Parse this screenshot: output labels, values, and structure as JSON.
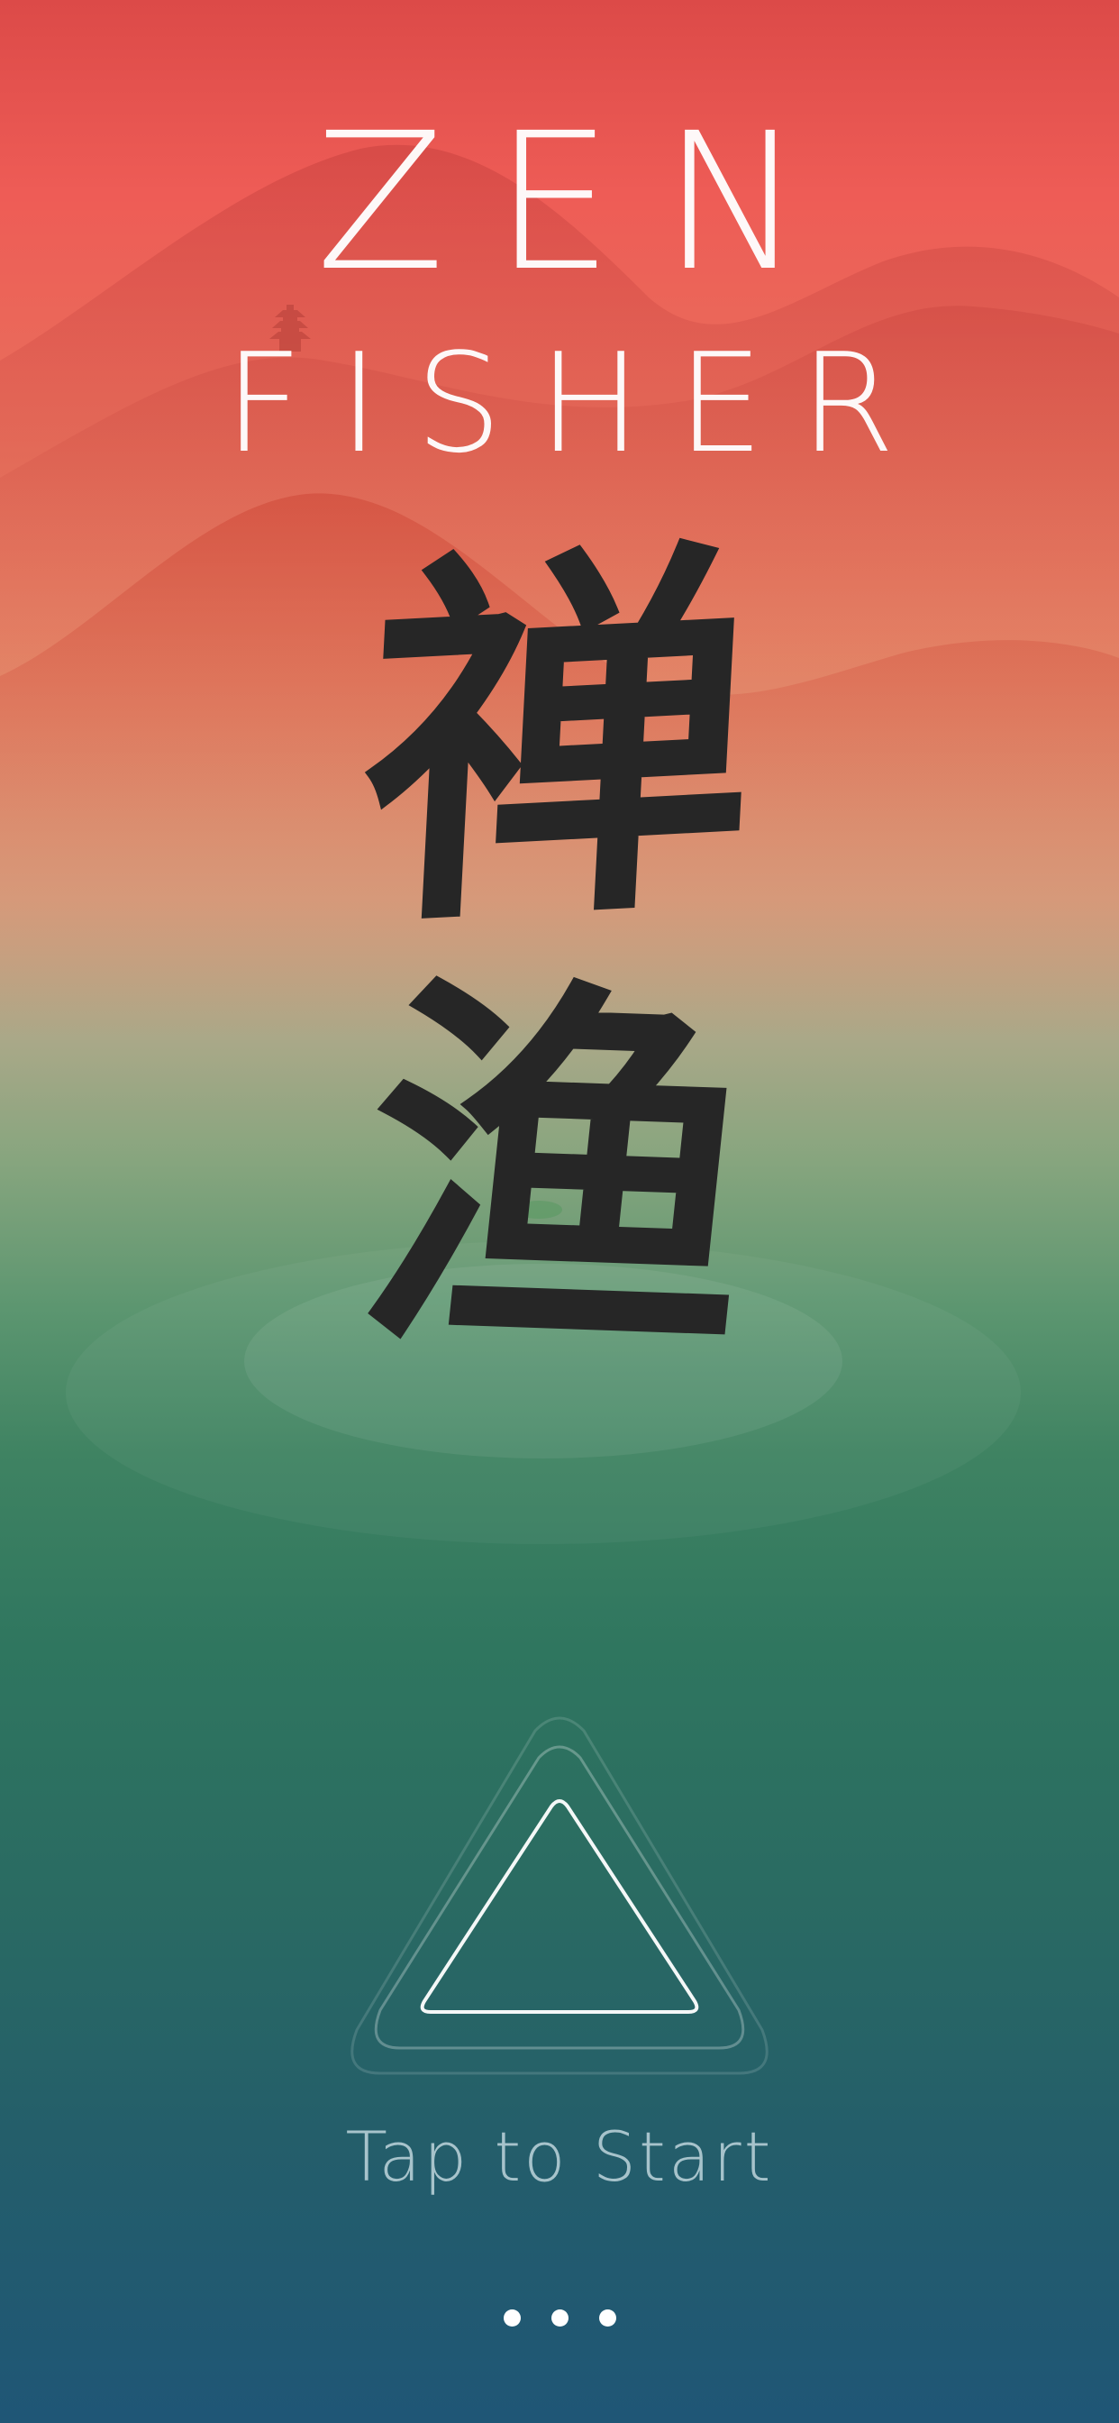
{
  "title": {
    "line1": "ZEN",
    "line2": "FISHER"
  },
  "calligraphy": {
    "char1": "禅",
    "char2": "渔"
  },
  "start": {
    "label": "Tap to Start",
    "icon": "play-triangle-icon"
  },
  "menu": {
    "icon": "more-dots-icon"
  },
  "colors": {
    "sky_top": "#dc4a48",
    "horizon": "#a9a888",
    "water": "#3f8362",
    "bottom": "#1f5676",
    "title": "#ffffff",
    "ink": "#262626",
    "start_label": "#a7c3cb"
  }
}
